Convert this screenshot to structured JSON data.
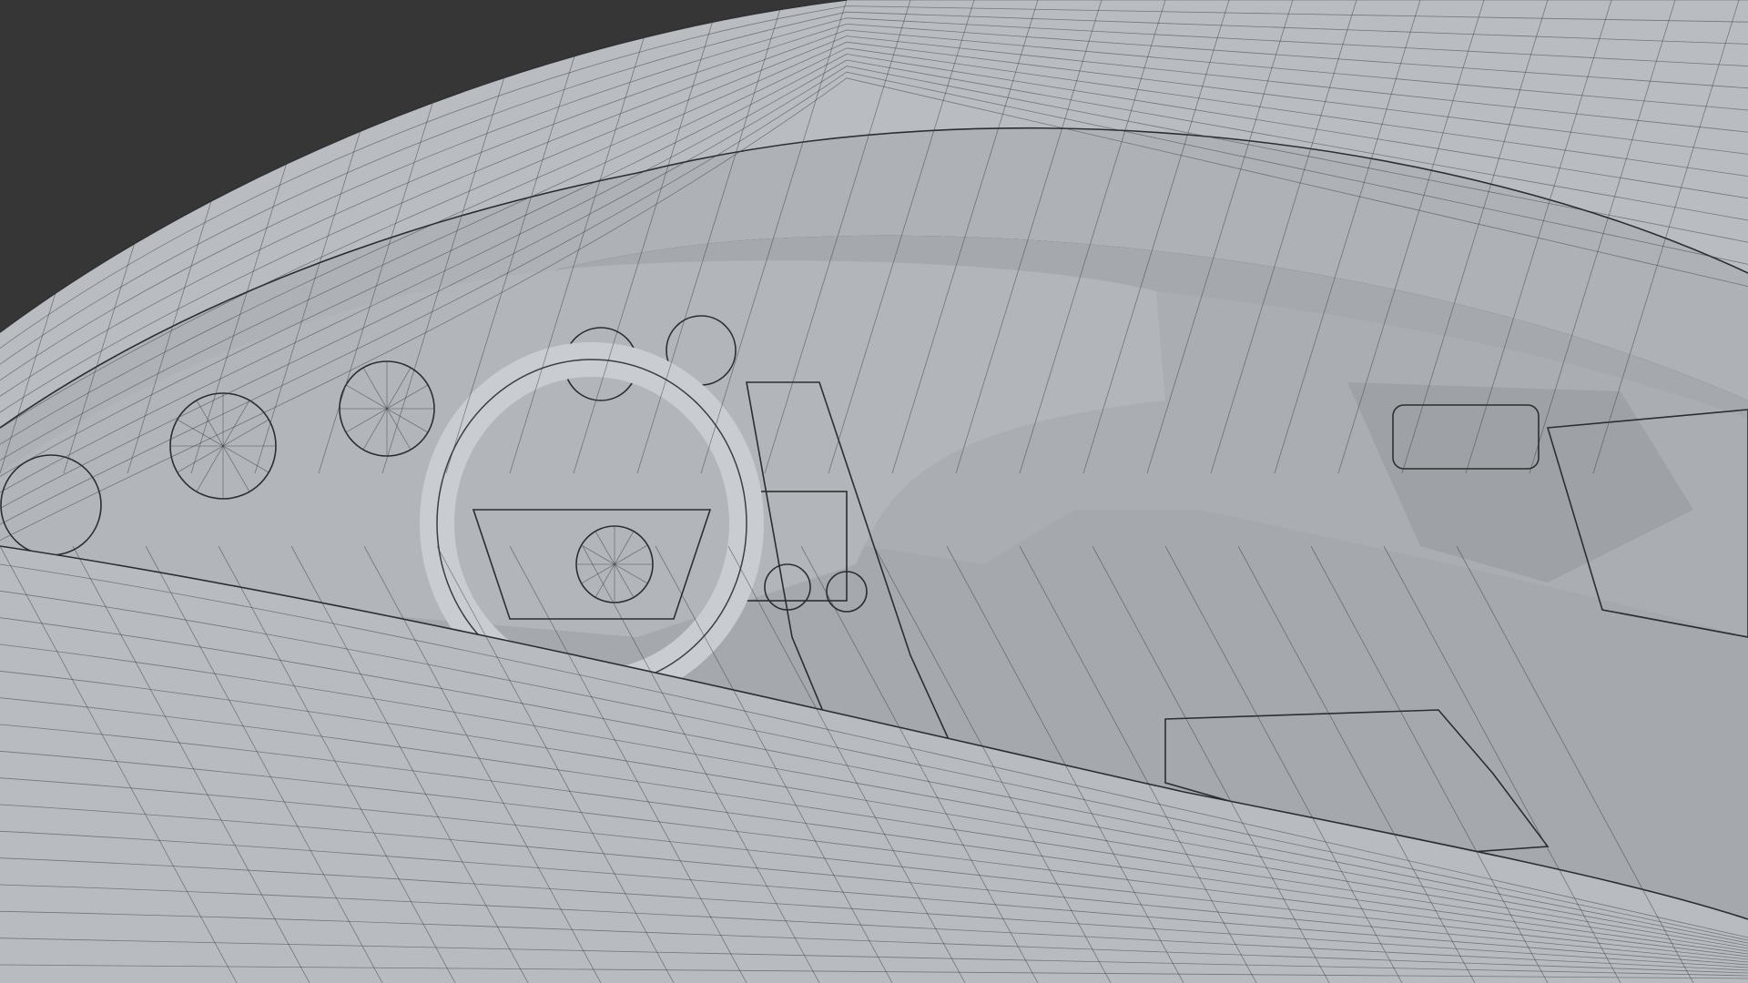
{
  "scene": {
    "background_color": "#363636",
    "surface_color": "#b6babf",
    "interior_color": "#a7abb0",
    "shadow_color": "#8d9196",
    "wire_color": "#3a3d42",
    "objects": [
      "roof",
      "windshield-frame",
      "dashboard",
      "instrument-cluster",
      "steering-wheel",
      "center-console",
      "passenger-dash",
      "door-panel",
      "seat"
    ]
  }
}
